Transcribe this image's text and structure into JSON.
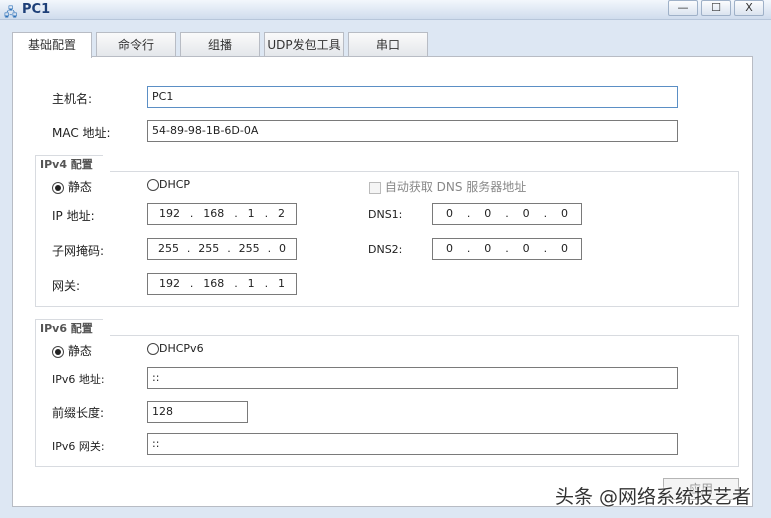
{
  "window": {
    "title": "PC1",
    "minimize": "—",
    "maximize": "☐",
    "close": "X"
  },
  "tabs": [
    {
      "label": "基础配置"
    },
    {
      "label": "命令行"
    },
    {
      "label": "组播"
    },
    {
      "label": "UDP发包工具"
    },
    {
      "label": "串口"
    }
  ],
  "basic": {
    "hostname_label": "主机名:",
    "hostname": "PC1",
    "mac_label": "MAC 地址:",
    "mac": "54-89-98-1B-6D-0A"
  },
  "ipv4": {
    "title": "IPv4 配置",
    "static": "静态",
    "dhcp": "DHCP",
    "auto_dns": "自动获取 DNS 服务器地址",
    "ip_label": "IP 地址:",
    "ip": [
      "192",
      "168",
      "1",
      "2"
    ],
    "mask_label": "子网掩码:",
    "mask": [
      "255",
      "255",
      "255",
      "0"
    ],
    "gw_label": "网关:",
    "gw": [
      "192",
      "168",
      "1",
      "1"
    ],
    "dns1_label": "DNS1:",
    "dns1": [
      "0",
      "0",
      "0",
      "0"
    ],
    "dns2_label": "DNS2:",
    "dns2": [
      "0",
      "0",
      "0",
      "0"
    ]
  },
  "ipv6": {
    "title": "IPv6 配置",
    "static": "静态",
    "dhcp": "DHCPv6",
    "addr_label": "IPv6 地址:",
    "addr": "::",
    "prefix_label": "前缀长度:",
    "prefix": "128",
    "gw_label": "IPv6 网关:",
    "gw": "::"
  },
  "apply": "应用",
  "watermark": "头条 @网络系统技艺者"
}
